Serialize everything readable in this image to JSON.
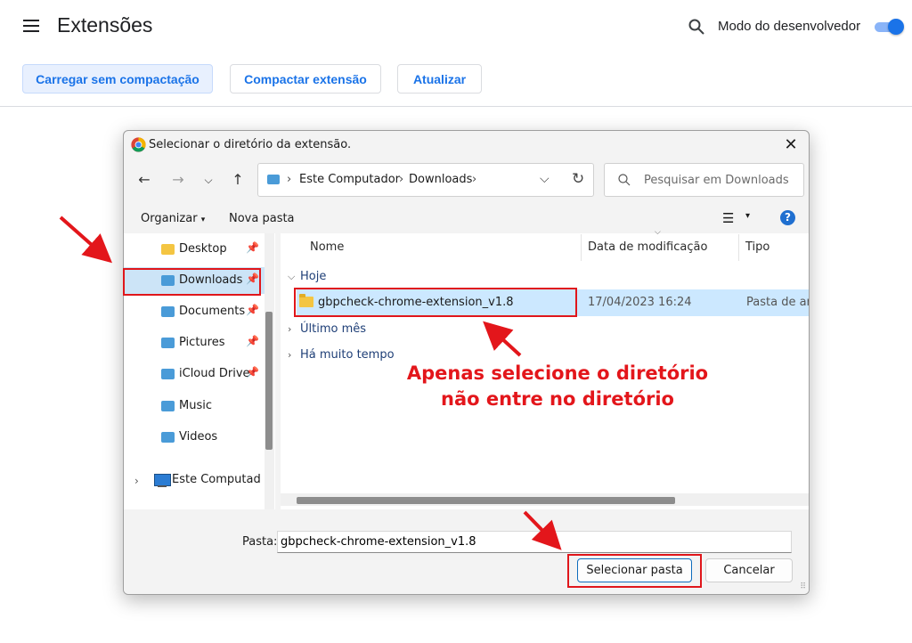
{
  "page": {
    "title": "Extensões",
    "dev_mode_label": "Modo do desenvolvedor",
    "dev_mode_enabled": true,
    "buttons": {
      "load_unpacked": "Carregar sem compactação",
      "pack": "Compactar extensão",
      "update": "Atualizar"
    },
    "accent_color": "#1a73e8"
  },
  "dialog": {
    "title": "Selecionar o diretório da extensão.",
    "breadcrumb": [
      "Este Computador",
      "Downloads"
    ],
    "search_placeholder": "Pesquisar em Downloads",
    "toolbar": {
      "organize": "Organizar",
      "new_folder": "Nova pasta"
    },
    "nav": [
      {
        "label": "Desktop",
        "icon": "desktop-folder-icon",
        "pinned": true
      },
      {
        "label": "Downloads",
        "icon": "downloads-folder-icon",
        "pinned": true,
        "selected": true
      },
      {
        "label": "Documents",
        "icon": "documents-folder-icon",
        "pinned": true
      },
      {
        "label": "Pictures",
        "icon": "pictures-folder-icon",
        "pinned": true
      },
      {
        "label": "iCloud Drive",
        "icon": "cloud-folder-icon",
        "pinned": true
      },
      {
        "label": "Music",
        "icon": "music-folder-icon",
        "pinned": false
      },
      {
        "label": "Videos",
        "icon": "videos-folder-icon",
        "pinned": false
      },
      {
        "label": "Este Computador",
        "icon": "computer-icon"
      }
    ],
    "columns": {
      "name": "Nome",
      "date": "Data de modificação",
      "type": "Tipo"
    },
    "groups": {
      "today": "Hoje",
      "last_month": "Último mês",
      "long_ago": "Há muito tempo"
    },
    "file": {
      "name": "gbpcheck-chrome-extension_v1.8",
      "date": "17/04/2023 16:24",
      "type": "Pasta de arq"
    },
    "folder_label": "Pasta:",
    "folder_value": "gbpcheck-chrome-extension_v1.8",
    "select_button": "Selecionar pasta",
    "cancel_button": "Cancelar"
  },
  "annotation": {
    "line1": "Apenas selecione o diretório",
    "line2": "não entre no diretório",
    "color": "#e3161b"
  }
}
